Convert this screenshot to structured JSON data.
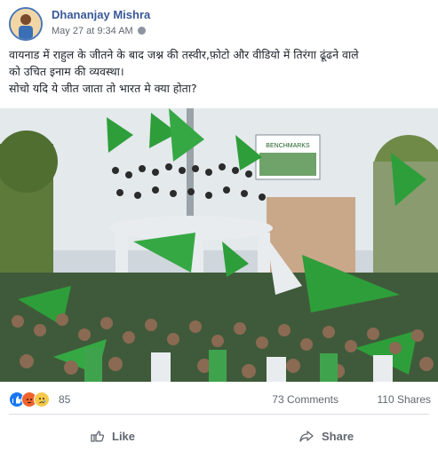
{
  "post": {
    "author": "Dhananjay Mishra",
    "timestamp": "May 27 at 9:34 AM",
    "privacy_icon": "globe-icon",
    "text_lines": [
      "वायनाड में राहुल के जीतने के बाद जश्न की तस्वीर,फ़ोटो और वीडियो में तिरंगा ढूंढने वाले",
      "को उचित इनाम की व्यवस्था।",
      "सोचो यदि ये जीत जाता तो भारत मे क्या होता?"
    ],
    "photo": {
      "billboard_text": "BENCHMARKS",
      "flag_color": "#2e9e3a"
    }
  },
  "stats": {
    "reaction_icons": [
      "like-icon",
      "angry-icon",
      "sad-icon"
    ],
    "reaction_count": "85",
    "comments": "73 Comments",
    "shares": "110 Shares"
  },
  "actions": {
    "like": "Like",
    "share": "Share"
  },
  "colors": {
    "author": "#385898",
    "meta": "#616770",
    "like_blue": "#1877f2",
    "angry": "#f0632c",
    "sad": "#f7c84a"
  }
}
